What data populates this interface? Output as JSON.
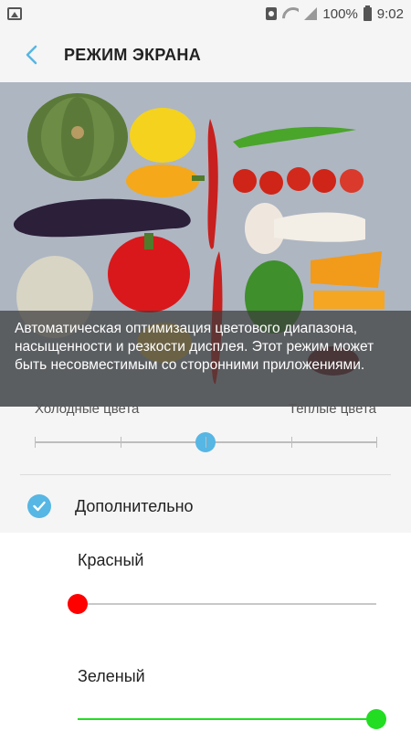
{
  "status_bar": {
    "battery_text": "100%",
    "time": "9:02",
    "icons": [
      "image-icon",
      "nfc-icon",
      "wifi-icon",
      "signal-icon",
      "battery-icon"
    ]
  },
  "app_bar": {
    "title": "РЕЖИМ ЭКРАНА",
    "back_icon": "chevron-left-icon"
  },
  "hero": {
    "caption": "Автоматическая оптимизация цветового диапазона, насыщенности и резкости дисплея. Этот режим может быть несовместимым со сторонними приложениями."
  },
  "temperature": {
    "left_label": "Холодные цвета",
    "right_label": "Теплые цвета",
    "steps": 5,
    "value_step": 3
  },
  "advanced": {
    "label": "Дополнительно",
    "checked": true
  },
  "rgb": {
    "red": {
      "label": "Красный",
      "level": 0,
      "color": "#ff0000"
    },
    "green": {
      "label": "Зеленый",
      "level": 1,
      "color": "#22dd22"
    }
  },
  "colors": {
    "accent": "#56b6e4",
    "background": "#f5f5f5"
  }
}
